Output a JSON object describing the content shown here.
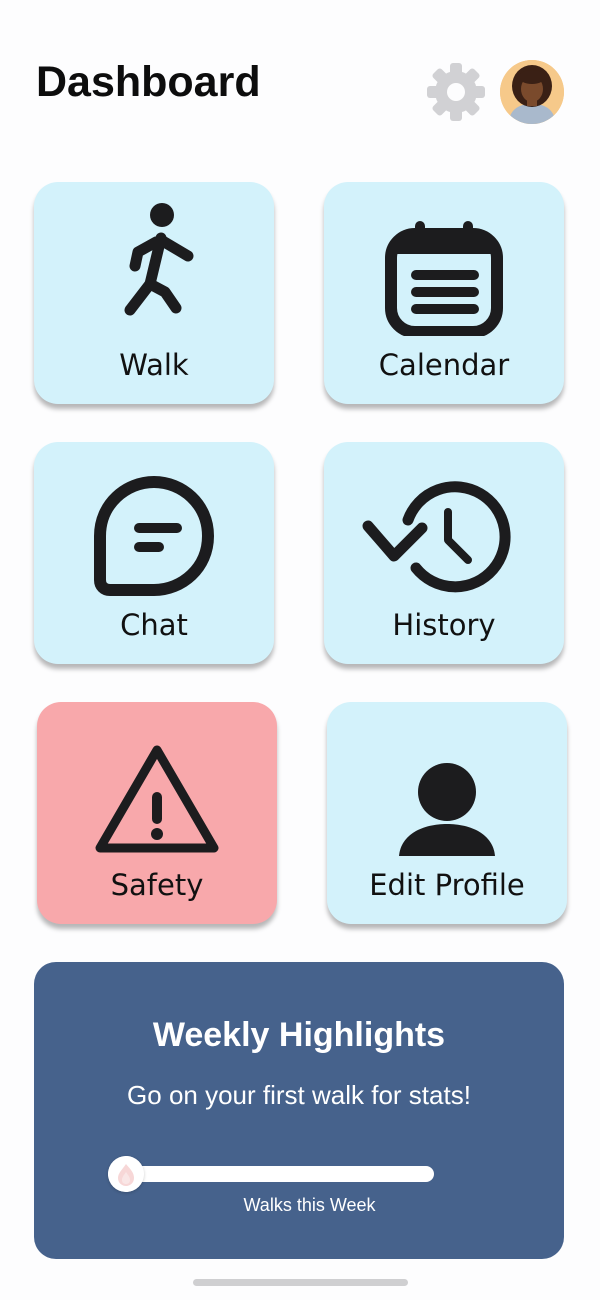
{
  "header": {
    "title": "Dashboard"
  },
  "icons": {
    "settings": "gear-icon",
    "profile": "avatar"
  },
  "tiles": [
    {
      "label": "Walk",
      "icon": "walk-icon",
      "color": "#d3f2fb"
    },
    {
      "label": "Calendar",
      "icon": "calendar-icon",
      "color": "#d3f2fb"
    },
    {
      "label": "Chat",
      "icon": "chat-icon",
      "color": "#d3f2fb"
    },
    {
      "label": "History",
      "icon": "history-icon",
      "color": "#d3f2fb"
    },
    {
      "label": "Safety",
      "icon": "warning-icon",
      "color": "#f8a8ab"
    },
    {
      "label": "Edit Profile",
      "icon": "person-icon",
      "color": "#d3f2fb"
    }
  ],
  "highlights": {
    "title": "Weekly Highlights",
    "subtitle": "Go on your first walk for stats!",
    "progress_caption": "Walks this Week",
    "progress_value": 0,
    "color": "#46628c"
  }
}
